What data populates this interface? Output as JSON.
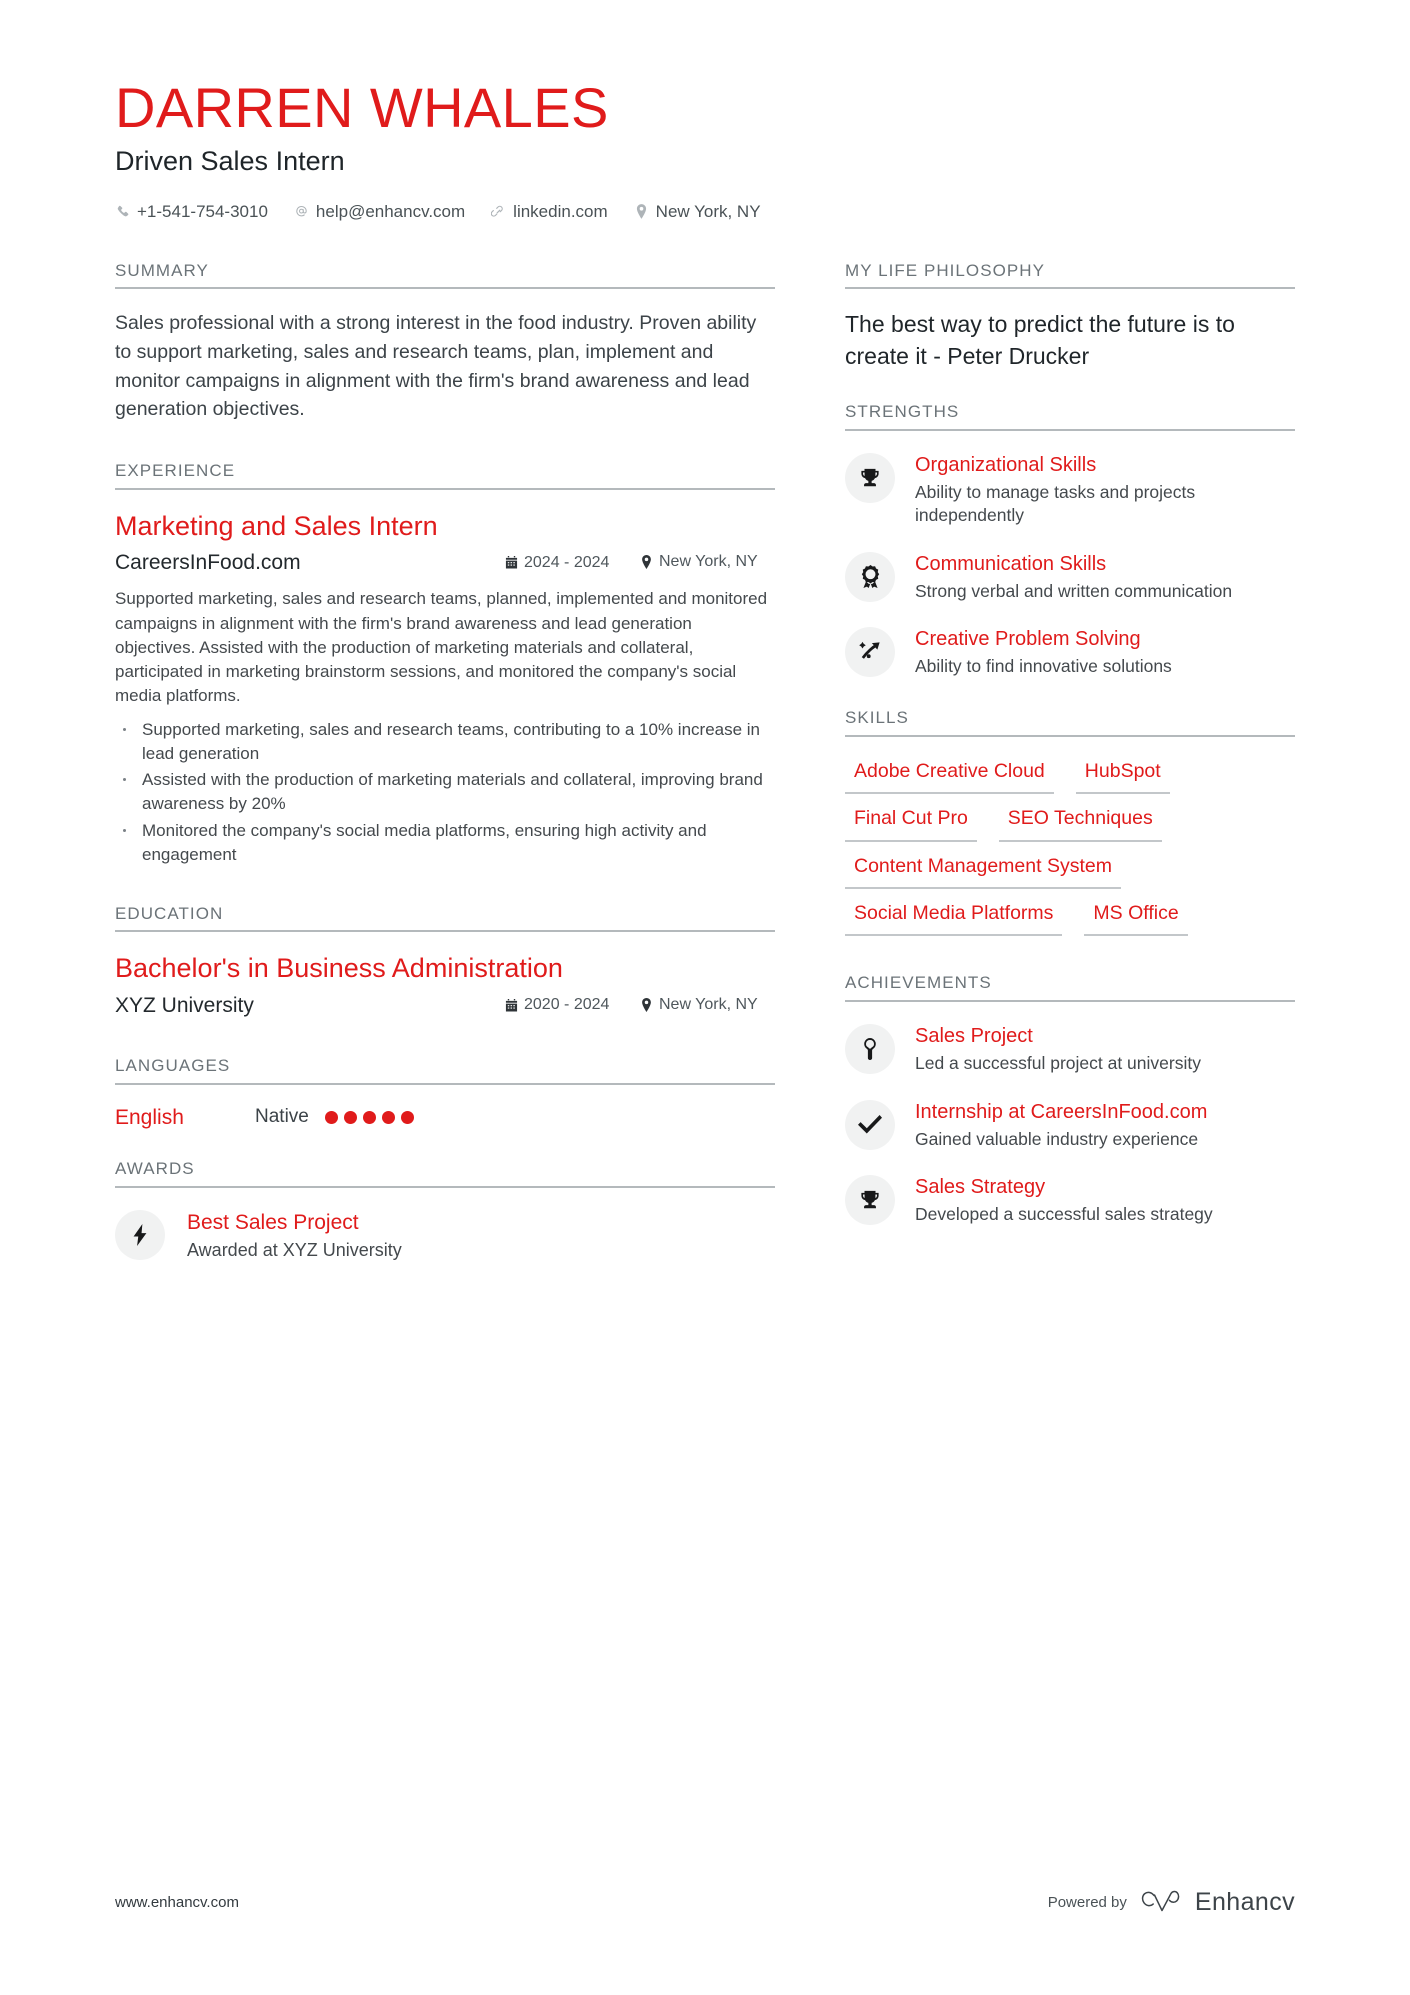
{
  "header": {
    "name": "DARREN WHALES",
    "title": "Driven Sales Intern",
    "contacts": [
      {
        "icon": "phone-icon",
        "text": "+1-541-754-3010"
      },
      {
        "icon": "email-icon",
        "text": "help@enhancv.com"
      },
      {
        "icon": "link-icon",
        "text": "linkedin.com"
      },
      {
        "icon": "location-pin-icon",
        "text": "New York, NY"
      }
    ]
  },
  "colors": {
    "accent": "#e01b1b",
    "heading": "#6b7378",
    "rule": "#b4b9bc",
    "body": "#44494d",
    "badge_bg": "#f1f2f2"
  },
  "left": {
    "summary": {
      "heading": "SUMMARY",
      "text": "Sales professional with a strong interest in the food industry. Proven ability to support marketing, sales and research teams, plan, implement and monitor campaigns in alignment with the firm's brand awareness and lead generation objectives."
    },
    "experience": {
      "heading": "EXPERIENCE",
      "entries": [
        {
          "title": "Marketing and Sales Intern",
          "org": "CareersInFood.com",
          "date": "2024 - 2024",
          "location": "New York, NY",
          "description": "Supported marketing, sales and research teams, planned, implemented and monitored campaigns in alignment with the firm's brand awareness and lead generation objectives. Assisted with the production of marketing materials and collateral, participated in marketing brainstorm sessions, and monitored the company's social media platforms.",
          "bullets": [
            "Supported marketing, sales and research teams, contributing to a 10% increase in lead generation",
            "Assisted with the production of marketing materials and collateral, improving brand awareness by 20%",
            "Monitored the company's social media platforms, ensuring high activity and engagement"
          ]
        }
      ]
    },
    "education": {
      "heading": "EDUCATION",
      "entries": [
        {
          "title": "Bachelor's in Business Administration",
          "org": "XYZ University",
          "date": "2020 - 2024",
          "location": "New York, NY"
        }
      ]
    },
    "languages": {
      "heading": "LANGUAGES",
      "items": [
        {
          "name": "English",
          "level": "Native",
          "dots_filled": 5,
          "dots_total": 5
        }
      ]
    },
    "awards": {
      "heading": "AWARDS",
      "items": [
        {
          "icon": "lightning-bolt-icon",
          "title": "Best Sales Project",
          "description": "Awarded at XYZ University"
        }
      ]
    }
  },
  "right": {
    "philosophy": {
      "heading": "MY LIFE PHILOSOPHY",
      "quote": "The best way to predict the future is to create it - Peter Drucker"
    },
    "strengths": {
      "heading": "STRENGTHS",
      "items": [
        {
          "icon": "trophy-icon",
          "title": "Organizational Skills",
          "description": "Ability to manage tasks and projects independently"
        },
        {
          "icon": "award-ribbon-icon",
          "title": "Communication Skills",
          "description": "Strong verbal and written communication"
        },
        {
          "icon": "trajectory-arrow-icon",
          "title": "Creative Problem Solving",
          "description": "Ability to find innovative solutions"
        }
      ]
    },
    "skills": {
      "heading": "SKILLS",
      "items": [
        "Adobe Creative Cloud",
        "HubSpot",
        "Final Cut Pro",
        "SEO Techniques",
        "Content Management System",
        "Social Media Platforms",
        "MS Office"
      ]
    },
    "achievements": {
      "heading": "ACHIEVEMENTS",
      "items": [
        {
          "icon": "lightbulb-icon",
          "title": "Sales Project",
          "description": "Led a successful project at university"
        },
        {
          "icon": "checkmark-icon",
          "title": "Internship at CareersInFood.com",
          "description": "Gained valuable industry experience"
        },
        {
          "icon": "trophy-icon",
          "title": "Sales Strategy",
          "description": "Developed a successful sales strategy"
        }
      ]
    }
  },
  "footer": {
    "website": "www.enhancv.com",
    "powered_by": "Powered by",
    "brand": "Enhancv"
  }
}
